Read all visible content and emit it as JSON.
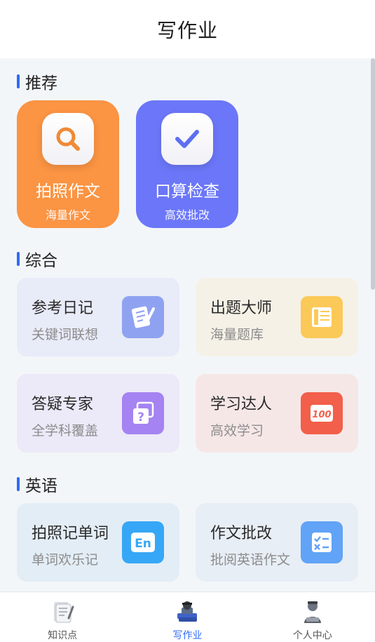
{
  "header": {
    "title": "写作业"
  },
  "sections": {
    "recommend": {
      "title": "推荐"
    },
    "general": {
      "title": "综合"
    },
    "english": {
      "title": "英语"
    }
  },
  "recommend": [
    {
      "title": "拍照作文",
      "sub": "海量作文",
      "color": "#fb9443",
      "icon": "search-icon"
    },
    {
      "title": "口算检查",
      "sub": "高效批改",
      "color": "#6b77f8",
      "icon": "check-icon"
    }
  ],
  "general": [
    {
      "title": "参考日记",
      "sub": "关键词联想",
      "bg": "#e8ebf8",
      "icon_color": "#8fa2f1",
      "icon": "diary-icon"
    },
    {
      "title": "出题大师",
      "sub": "海量题库",
      "bg": "#f5f1e6",
      "icon_color": "#fbc957",
      "icon": "book-icon"
    },
    {
      "title": "答疑专家",
      "sub": "全学科覆盖",
      "bg": "#ece9f8",
      "icon_color": "#a583f2",
      "icon": "question-icon"
    },
    {
      "title": "学习达人",
      "sub": "高效学习",
      "bg": "#f6e7e7",
      "icon_color": "#f25f4a",
      "icon": "score-100-icon",
      "icon_text": "100"
    }
  ],
  "english": [
    {
      "title": "拍照记单词",
      "sub": "单词欢乐记",
      "bg": "#e3edf6",
      "icon_color": "#36a7f6",
      "icon": "en-icon",
      "icon_text": "En"
    },
    {
      "title": "作文批改",
      "sub": "批阅英语作文",
      "bg": "#e8eef6",
      "icon_color": "#61a3f6",
      "icon": "checklist-icon"
    }
  ],
  "tabs": [
    {
      "label": "知识点",
      "active": false
    },
    {
      "label": "写作业",
      "active": true
    },
    {
      "label": "个人中心",
      "active": false
    }
  ],
  "colors": {
    "accent": "#2f6bf6"
  }
}
